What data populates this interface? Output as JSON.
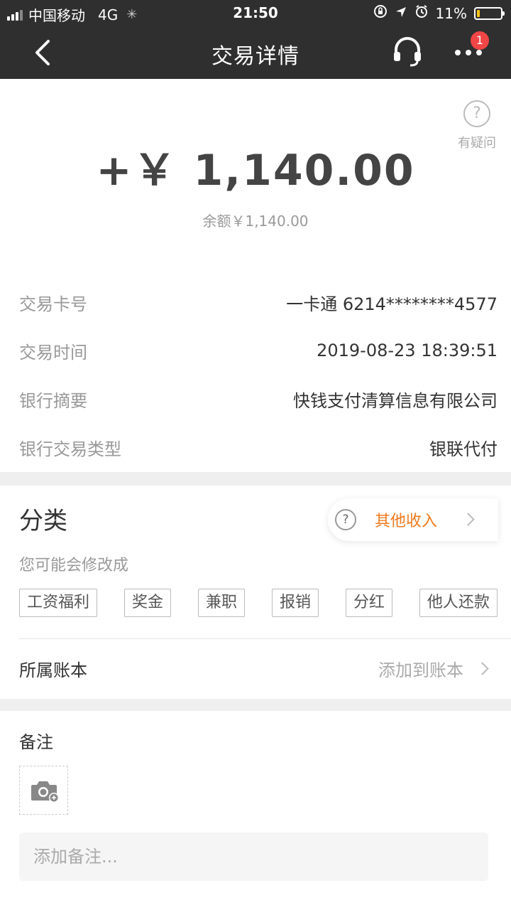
{
  "status_bar": {
    "carrier": "中国移动",
    "network": "4G",
    "time": "21:50",
    "battery": "11%",
    "battery_level": 0.11,
    "icons": [
      "signal-icon",
      "loading-icon",
      "lock-rotation-icon",
      "location-icon",
      "alarm-icon",
      "battery-icon"
    ]
  },
  "nav": {
    "title": "交易详情",
    "badge_count": "1",
    "icons": [
      "back-icon",
      "headset-icon",
      "more-icon"
    ]
  },
  "summary": {
    "amount": "+￥ 1,140.00",
    "balance": "余额￥1,140.00",
    "help_label": "有疑问"
  },
  "details": [
    {
      "label": "交易卡号",
      "value": "一卡通 6214********4577"
    },
    {
      "label": "交易时间",
      "value": "2019-08-23 18:39:51"
    },
    {
      "label": "银行摘要",
      "value": "快钱支付清算信息有限公司"
    },
    {
      "label": "银行交易类型",
      "value": "银联代付"
    }
  ],
  "category": {
    "title": "分类",
    "current": "其他收入",
    "hint": "您可能会修改成",
    "tags": [
      "工资福利",
      "奖金",
      "兼职",
      "报销",
      "分红",
      "他人还款"
    ],
    "accent_color": "#f07a1e"
  },
  "ledger": {
    "label": "所属账本",
    "action": "添加到账本"
  },
  "remark": {
    "title": "备注",
    "placeholder": "添加备注..."
  }
}
